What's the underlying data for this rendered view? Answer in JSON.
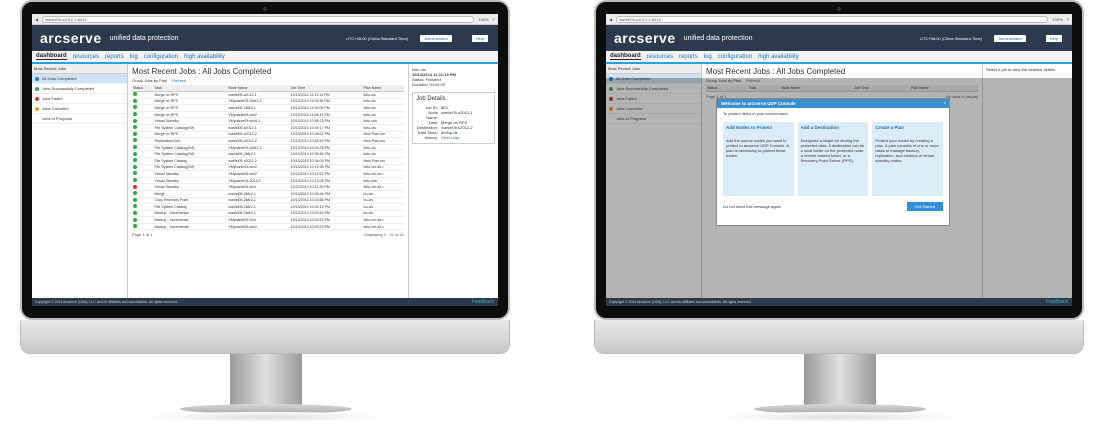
{
  "browser": {
    "url": "wanlei05-s2012-2:8015",
    "zoom": "100%"
  },
  "app": {
    "logo": "arcserve",
    "tagline": "unified data protection",
    "timezone": "UTC+08:00 (China Standard Time)",
    "admin": "Administrator",
    "help": "Help",
    "feedback": "Feedback"
  },
  "nav": [
    "dashboard",
    "resources",
    "reports",
    "log",
    "configuration",
    "high availability"
  ],
  "left": {
    "header": "Most Recent Jobs",
    "items": [
      {
        "label": "All Jobs Completed",
        "color": "#2a7fd4"
      },
      {
        "label": "Jobs Successfully Completed",
        "color": "#2fa84f"
      },
      {
        "label": "Jobs Failed",
        "color": "#d9342b"
      },
      {
        "label": "Jobs Canceled",
        "color": "#f09a1a"
      },
      {
        "label": "Jobs In Progress",
        "color": "#ffffff"
      }
    ]
  },
  "main": {
    "title": "Most Recent Jobs : All Jobs Completed",
    "group": "Group Jobs by Plan",
    "refresh": "Refresh",
    "columns": [
      "Status",
      "Task",
      "Node Name",
      "Job Time",
      "Plan Name"
    ],
    "rows": [
      [
        "Merge on RPS",
        "wanlei05-s2012-1",
        "10/13/2014 11:11:13 PM",
        "fctlu-cls"
      ],
      [
        "Merge on RPS",
        "VMyoanle05-2k8r2-2",
        "10/13/2014 11:09:38 PM",
        "fctlu-cls"
      ],
      [
        "Merge on RPS",
        "wanlei05-2k8r2-1",
        "10/13/2014 11:09:05 PM",
        "fctlu-cls"
      ],
      [
        "Merge on RPS",
        "VMyoanle05-win2",
        "10/13/2014 11:08:42 PM",
        "fctlu-cls"
      ],
      [
        "Virtual Standby",
        "VMyoanle05-win8-1",
        "10/13/2014 10:58:23 PM",
        "fctlu-vsb"
      ],
      [
        "File System Catalog(VM)",
        "wanlei05-s2012-1",
        "10/13/2014 10:49:17 PM",
        "fctlu-cls"
      ],
      [
        "Merge on RPS",
        "wanlei05-s2012-2",
        "10/13/2014 10:46:02 PM",
        "New Plan-mo"
      ],
      [
        "Replication(Out)",
        "wanlei05-s2012-2",
        "10/13/2014 10:44:49 PM",
        "New Plan-mo"
      ],
      [
        "File System Catalog(VM)",
        "VMyoanle05-2k8r2-2",
        "10/13/2014 10:42:28 PM",
        "fctlu-cls"
      ],
      [
        "File System Catalog(VM)",
        "wanlei05-2k8r2-1",
        "10/13/2014 10:39:55 PM",
        "fctlu-cls"
      ],
      [
        "File System Catalog",
        "wanlei05-s2012-2",
        "10/13/2014 10:36:09 PM",
        "New Plan-mo"
      ],
      [
        "File System Catalog(VM)",
        "VMyoanle05-win2",
        "10/13/2014 10:12:35 PM",
        "fctlu-vm-de-r"
      ],
      [
        "Virtual Standby",
        "VMyoanle05-win2",
        "10/13/2014 10:13:22 PM",
        "fctlu-vm-de-r"
      ],
      [
        "Virtual Standby",
        "VMyoanle05-2012r2",
        "10/13/2014 10:13:05 PM",
        "fctlu-vsb"
      ],
      [
        "Virtual Standby",
        "VMyoanle05-Win",
        "10/13/2014 10:11:39 PM",
        "fctlu-vm-de-r"
      ],
      [
        "Merge",
        "wanlei05-2k8r2-1",
        "10/13/2014 10:04:46 PM",
        "bu-cls"
      ],
      [
        "Copy Recovery Point",
        "wanlei05-2k8r2-1",
        "10/13/2014 10:03:56 PM",
        "bu-cls"
      ],
      [
        "File System Catalog",
        "wanlei05-2k8r2-1",
        "10/13/2014 10:02:13 PM",
        "bu-cls"
      ],
      [
        "Backup - Incremental",
        "wanlei05-2k8r2-1",
        "10/13/2014 10:00:40 PM",
        "bu-cls"
      ],
      [
        "Backup - Incremental",
        "VMyoanle05-Win",
        "10/13/2014 10:00:23 PM",
        "fctlu-vm-de-r"
      ],
      [
        "Backup - Incremental",
        "VMyoanle05-win2",
        "10/13/2014 10:00:23 PM",
        "fctlu-vm-de-r"
      ]
    ],
    "statuses": [
      "ok",
      "ok",
      "ok",
      "ok",
      "ok",
      "ok",
      "ok",
      "ok",
      "ok",
      "ok",
      "ok",
      "ok",
      "ok",
      "ok",
      "fail",
      "ok",
      "ok",
      "ok",
      "ok",
      "ok",
      "ok"
    ],
    "pager": "Page 1 of 1",
    "displaying": "Displaying 1 - 41 of 41"
  },
  "detail": {
    "plan": "fctlu-cls",
    "time": "10/13/2014 11:11:13 PM",
    "status": "Status: Finished",
    "duration": "Duration: 00:00:05",
    "heading": "Job Details",
    "fields": [
      [
        "Job ID:",
        "863"
      ],
      [
        "Node Name:",
        "wanlei05-s2012-1"
      ],
      [
        "Task:",
        "Merge on RPS"
      ],
      [
        "Destination:",
        "wanlei05-s2012-2"
      ],
      [
        "Data Store:",
        "dedup-ds"
      ],
      [
        "History:",
        "View Logs"
      ]
    ]
  },
  "screen2": {
    "hint": "Select a job to view the detailed details.",
    "nodata": "No data to display",
    "dialog": {
      "title": "Welcome to arcserve UDP Console",
      "intro": "To protect items in your environment:",
      "cards": [
        {
          "title": "Add Nodes to Protect",
          "text": "Add the source nodes you want to protect to arcserve UDP Console. A plan is necessary to protect these nodes."
        },
        {
          "title": "Add a Destination",
          "text": "Designate a target for storing the protected data. A destination can be a local folder on the protected node, a remote shared folder, or a Recovery Point Server (RPS)."
        },
        {
          "title": "Create a Plan",
          "text": "Protect your nodes by creating a plan. A plan consists of one or more tasks to manage backup, replication, and creation of virtual standby nodes."
        }
      ],
      "checkbox": "Do not show this message again",
      "button": "Get Started"
    }
  },
  "copyright": "Copyright © 2014 Arcserve (USA), LLC and its affiliates and subsidiaries. All rights reserved."
}
